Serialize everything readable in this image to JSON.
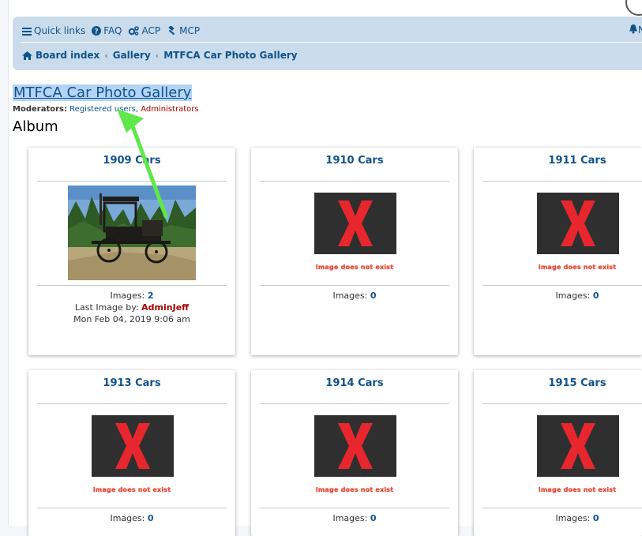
{
  "nav": {
    "quick_links": "Quick links",
    "faq": "FAQ",
    "acp": "ACP",
    "mcp": "MCP",
    "right_partial": "N"
  },
  "breadcrumb": {
    "items": [
      "Board index",
      "Gallery",
      "MTFCA Car Photo Gallery"
    ],
    "separator": "‹"
  },
  "page_title": "MTFCA Car Photo Gallery",
  "moderators": {
    "label": "Moderators:",
    "group1": "Registered users",
    "comma": ",",
    "group2": "Administrators"
  },
  "section_heading": "Album",
  "albums": [
    {
      "title": "1909 Cars",
      "has_image": true,
      "images_label": "Images:",
      "images_count": "2",
      "last_image_label": "Last Image by:",
      "last_image_user": "AdminJeff",
      "last_image_date": "Mon Feb 04, 2019 9:06 am"
    },
    {
      "title": "1910 Cars",
      "has_image": false,
      "missing_text": "Image does not exist",
      "images_label": "Images:",
      "images_count": "0"
    },
    {
      "title": "1911 Cars",
      "has_image": false,
      "missing_text": "Image does not exist",
      "images_label": "Images:",
      "images_count": "0"
    },
    {
      "title": "1913 Cars",
      "has_image": false,
      "missing_text": "Image does not exist",
      "images_label": "Images:",
      "images_count": "0"
    },
    {
      "title": "1914 Cars",
      "has_image": false,
      "missing_text": "Image does not exist",
      "images_label": "Images:",
      "images_count": "0"
    },
    {
      "title": "1915 Cars",
      "has_image": false,
      "missing_text": "Image does not exist",
      "images_label": "Images:",
      "images_count": "0"
    }
  ],
  "colors": {
    "link": "#105289",
    "navbar_bg": "#cadceb",
    "admin_red": "#AA0000",
    "annotation_arrow": "#5ee84a",
    "missing_x": "#e8262e"
  },
  "icons": {
    "quick_links": "bars-icon",
    "faq": "question-circle-icon",
    "acp": "cogs-icon",
    "mcp": "gavel-icon",
    "board_index": "home-icon",
    "notifications": "bell-icon",
    "missing_image": "red-x-icon"
  }
}
